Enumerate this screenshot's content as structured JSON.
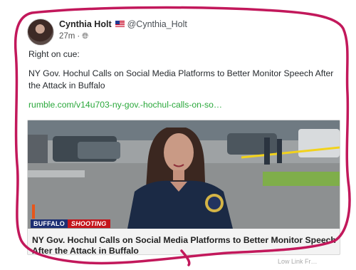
{
  "post": {
    "author_name": "Cynthia Holt",
    "handle": "@Cynthia_Holt",
    "time": "27m",
    "visibility_icon": "globe-icon",
    "flag_icon": "us-flag-icon",
    "text_intro": "Right on cue:",
    "text_headline": "NY Gov. Hochul Calls on Social Media Platforms to Better Monitor Speech After the Attack in Buffalo",
    "link_text": "rumble.com/v14u703-ny-gov.-hochul-calls-on-so…"
  },
  "preview": {
    "banner_place": "BUFFALO",
    "banner_tag": "SHOOTING",
    "title": "NY Gov. Hochul Calls on Social Media Platforms to Better Monitor Speech After the Attack in Buffalo"
  },
  "footer_text": "Low Link Fr…",
  "colors": {
    "link": "#2aa83b",
    "scribble": "#c2185b",
    "banner_blue": "#1c2f73",
    "banner_red": "#c4161c"
  }
}
